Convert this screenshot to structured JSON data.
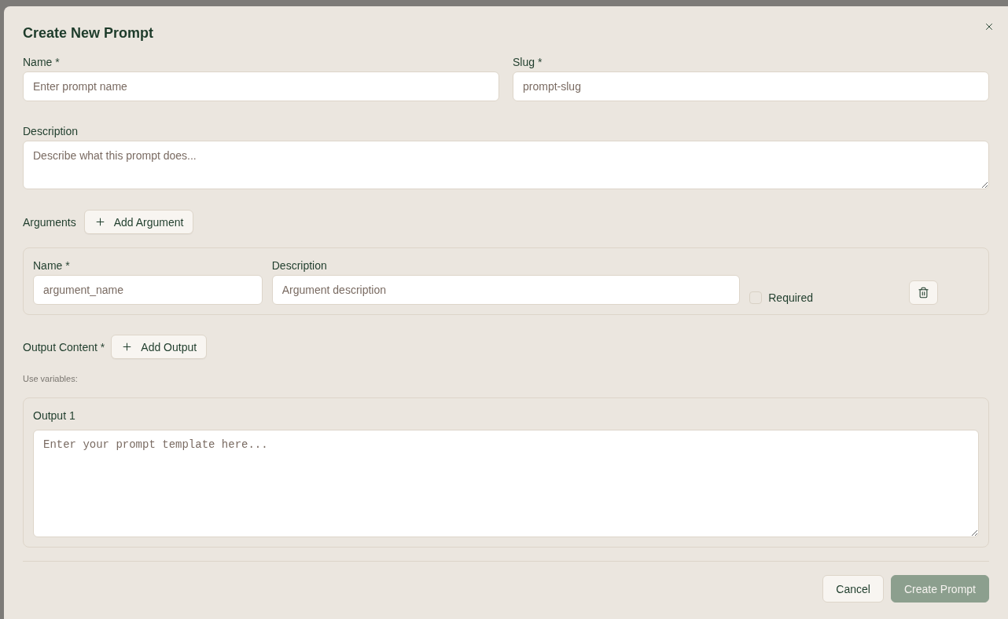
{
  "dialog": {
    "title": "Create New Prompt"
  },
  "fields": [
    {
      "label": "Name *",
      "placeholder": "Enter prompt name"
    },
    {
      "label": "Slug *",
      "placeholder": "prompt-slug"
    }
  ],
  "description": {
    "label": "Description",
    "placeholder": "Describe what this prompt does..."
  },
  "arguments": {
    "label": "Arguments",
    "add_button": "Add Argument",
    "items": [
      {
        "name_label": "Name *",
        "name_placeholder": "argument_name",
        "description_label": "Description",
        "description_placeholder": "Argument description",
        "required_label": "Required",
        "required": false
      }
    ]
  },
  "output": {
    "label": "Output Content *",
    "add_button": "Add Output",
    "hint": "Use variables:",
    "items": [
      {
        "label": "Output 1",
        "placeholder": "Enter your prompt template here..."
      }
    ]
  },
  "footer": {
    "buttons": [
      {
        "label": "Cancel",
        "kind": "secondary",
        "disabled": false
      },
      {
        "label": "Create Prompt",
        "kind": "primary",
        "disabled": true
      }
    ]
  }
}
